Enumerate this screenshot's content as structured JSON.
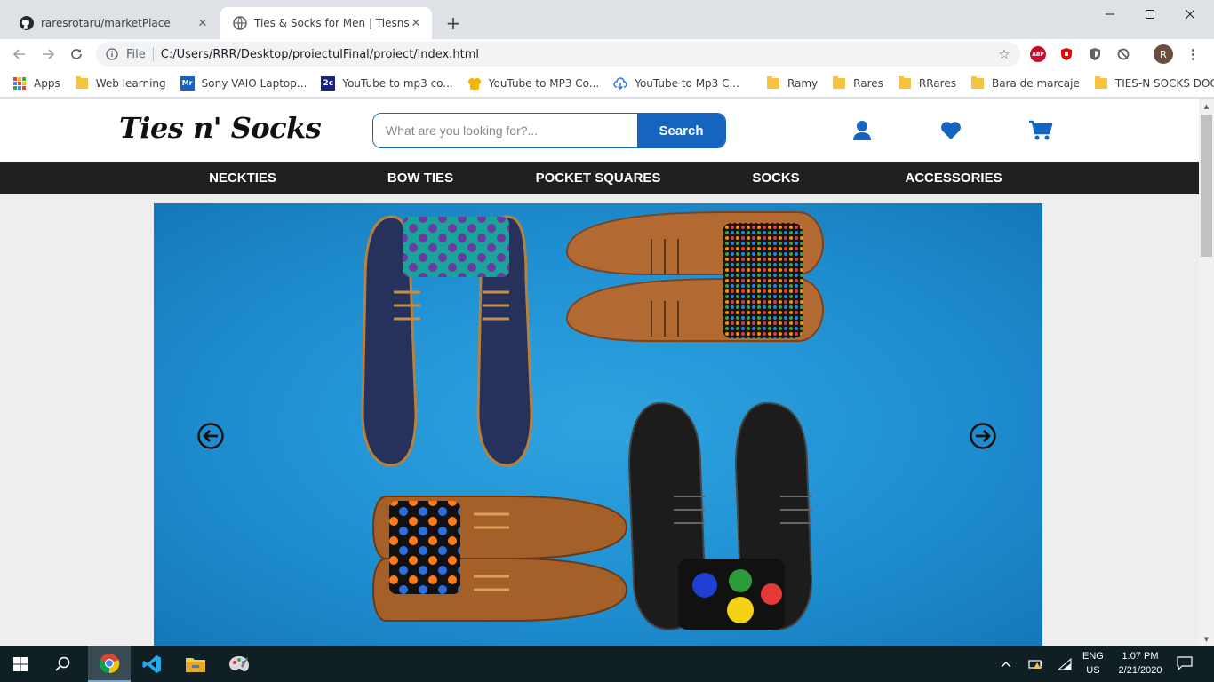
{
  "browser": {
    "tabs": [
      {
        "title": "raresrotaru/marketPlace",
        "icon": "github-icon",
        "active": false
      },
      {
        "title": "Ties & Socks for Men | Tiesnsocks",
        "icon": "globe-icon",
        "active": true
      }
    ],
    "address": {
      "scheme_label": "File",
      "url": "C:/Users/RRR/Desktop/proiectulFinal/proiect/index.html"
    },
    "profile_initial": "R",
    "extensions": {
      "abp_label": "ABP"
    },
    "bookmarks": [
      {
        "label": "Apps",
        "icon": "apps-grid-icon"
      },
      {
        "label": "Web learning",
        "icon": "folder-icon"
      },
      {
        "label": "Sony VAIO Laptop...",
        "icon": "mr-site-icon",
        "badge": "Mr"
      },
      {
        "label": "YouTube to mp3 co...",
        "icon": "2c-site-icon",
        "badge": "2c"
      },
      {
        "label": "YouTube to MP3 Co...",
        "icon": "yellow-site-icon"
      },
      {
        "label": "YouTube to Mp3 C...",
        "icon": "cloud-download-icon"
      },
      {
        "label": "Ramy",
        "icon": "folder-icon"
      },
      {
        "label": "Rares",
        "icon": "folder-icon"
      },
      {
        "label": "RRares",
        "icon": "folder-icon"
      },
      {
        "label": "Bara de marcaje",
        "icon": "folder-icon"
      },
      {
        "label": "TIES-N SOCKS DOCS",
        "icon": "folder-icon"
      }
    ]
  },
  "site": {
    "logo": "Ties n' Socks",
    "search": {
      "placeholder": "What are you looking for?...",
      "button": "Search"
    },
    "nav": [
      "NECKTIES",
      "BOW TIES",
      "POCKET SQUARES",
      "SOCKS",
      "ACCESSORIES"
    ],
    "colors": {
      "accent": "#1565c0",
      "nav_bg": "#202020",
      "hero_bg": "#1f8fd1"
    }
  },
  "taskbar": {
    "lang": {
      "line1": "ENG",
      "line2": "US"
    },
    "clock": {
      "time": "1:07 PM",
      "date": "2/21/2020"
    }
  }
}
